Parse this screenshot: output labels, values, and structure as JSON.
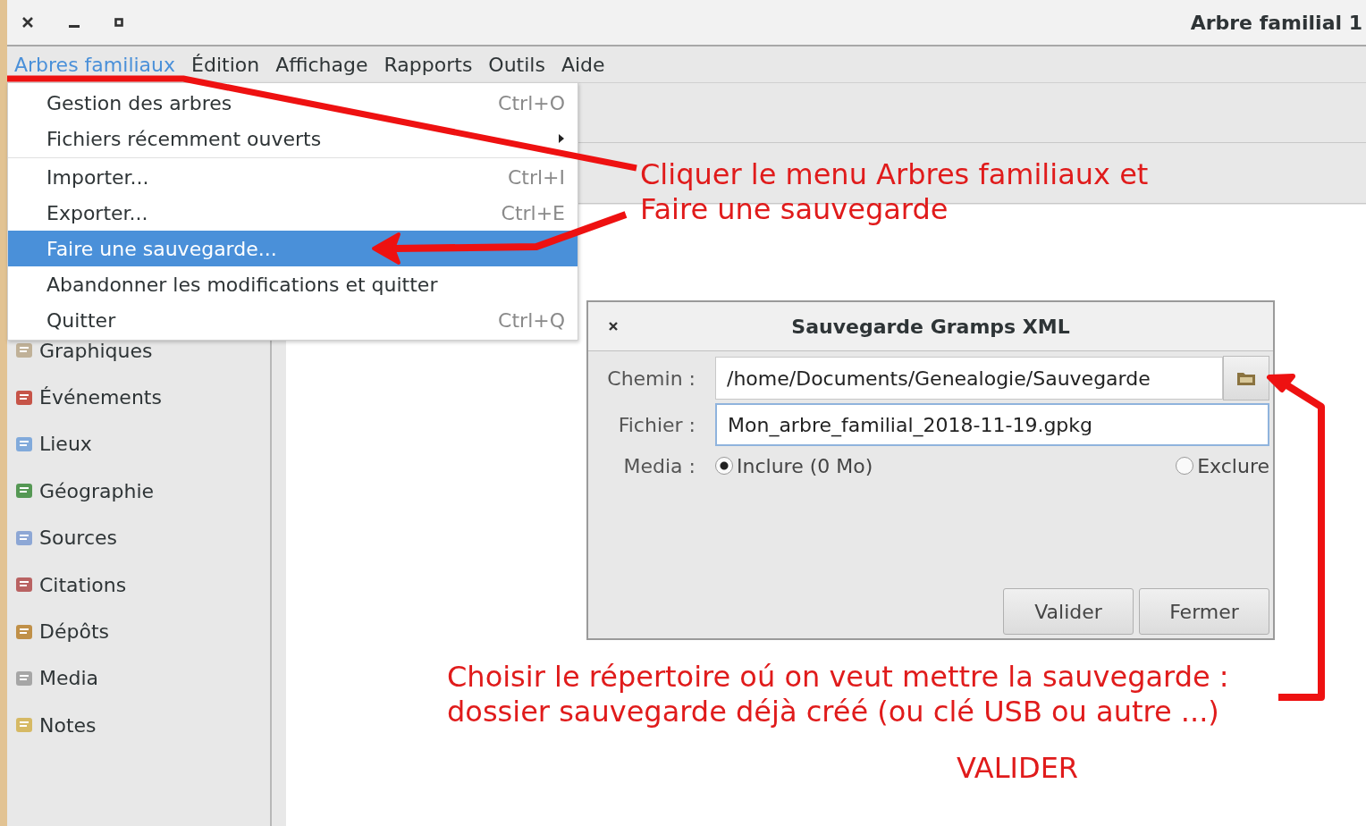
{
  "window": {
    "title": "Arbre familial 1"
  },
  "menubar": [
    {
      "label": "Arbres familiaux",
      "selected": true
    },
    {
      "label": "Édition",
      "selected": false
    },
    {
      "label": "Affichage",
      "selected": false
    },
    {
      "label": "Rapports",
      "selected": false
    },
    {
      "label": "Outils",
      "selected": false
    },
    {
      "label": "Aide",
      "selected": false
    }
  ],
  "menu": [
    {
      "kind": "item",
      "label": "Gestion des arbres",
      "shortcut": "Ctrl+O",
      "selected": false
    },
    {
      "kind": "submenu",
      "label": "Fichiers récemment ouverts",
      "selected": false
    },
    {
      "kind": "separator"
    },
    {
      "kind": "item",
      "label": "Importer...",
      "shortcut": "Ctrl+I",
      "selected": false
    },
    {
      "kind": "item",
      "label": "Exporter...",
      "shortcut": "Ctrl+E",
      "selected": false
    },
    {
      "kind": "item",
      "label": "Faire une sauvegarde...",
      "selected": true
    },
    {
      "kind": "item",
      "label": "Abandonner les modifications et quitter",
      "selected": false
    },
    {
      "kind": "item",
      "label": "Quitter",
      "shortcut": "Ctrl+Q",
      "selected": false
    }
  ],
  "sidebar": {
    "items": [
      {
        "label": "Graphiques"
      },
      {
        "label": "Événements"
      },
      {
        "label": "Lieux"
      },
      {
        "label": "Géographie"
      },
      {
        "label": "Sources"
      },
      {
        "label": "Citations"
      },
      {
        "label": "Dépôts"
      },
      {
        "label": "Media"
      },
      {
        "label": "Notes"
      }
    ]
  },
  "dialog": {
    "title": "Sauvegarde Gramps XML",
    "fields": [
      {
        "label": "Chemin :",
        "value": "/home/Documents/Genealogie/Sauvegarde",
        "focused": false,
        "browse": true
      },
      {
        "label": "Fichier :",
        "value": "Mon_arbre_familial_2018-11-19.gpkg",
        "focused": true,
        "browse": false
      }
    ],
    "media": {
      "label": "Media :",
      "options": [
        {
          "label": "Inclure (0 Mo)",
          "selected": true
        },
        {
          "label": "Exclure",
          "selected": false
        }
      ]
    },
    "buttons": [
      "Valider",
      "Fermer"
    ]
  },
  "annotations": [
    {
      "kind": "note",
      "text": "Cliquer le menu Arbres familiaux et\nFaire une sauvegarde"
    },
    {
      "kind": "note",
      "text": "Choisir le répertoire oú on veut mettre la sauvegarde :\ndossier sauvegarde déjà créé (ou clé USB ou autre ...)"
    },
    {
      "kind": "note",
      "text": "VALIDER"
    }
  ]
}
